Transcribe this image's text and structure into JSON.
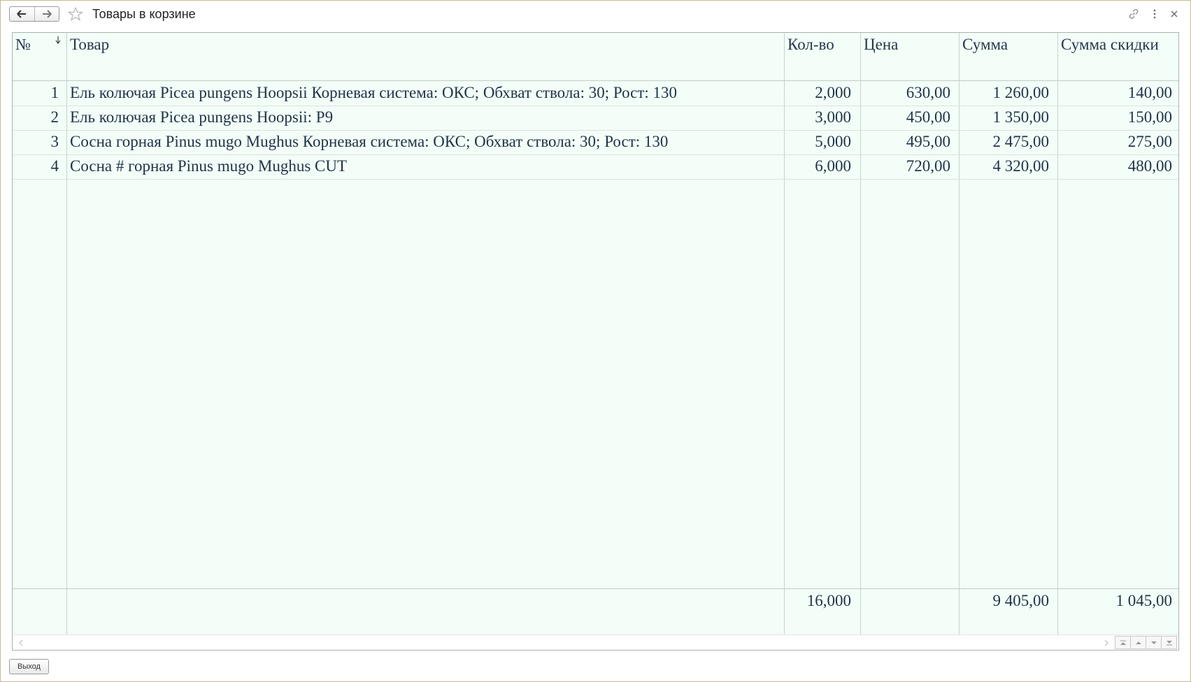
{
  "window": {
    "title": "Товары в корзине"
  },
  "table": {
    "columns": {
      "num": "№",
      "product": "Товар",
      "qty": "Кол-во",
      "price": "Цена",
      "sum": "Сумма",
      "discount": "Сумма скидки"
    },
    "rows": [
      {
        "num": "1",
        "product": "Ель колючая Picea pungens Hoopsii Корневая система: ОКС; Обхват ствола: 30; Рост: 130",
        "qty": "2,000",
        "price": "630,00",
        "sum": "1 260,00",
        "discount": "140,00"
      },
      {
        "num": "2",
        "product": "Ель колючая Picea pungens Hoopsii: Р9",
        "qty": "3,000",
        "price": "450,00",
        "sum": "1 350,00",
        "discount": "150,00"
      },
      {
        "num": "3",
        "product": "Сосна горная Pinus mugo Mughus  Корневая система: ОКС; Обхват ствола: 30; Рост: 130",
        "qty": "5,000",
        "price": "495,00",
        "sum": "2 475,00",
        "discount": "275,00"
      },
      {
        "num": "4",
        "product": "Сосна # горная Pinus mugo Mughus CUT",
        "qty": "6,000",
        "price": "720,00",
        "sum": "4 320,00",
        "discount": "480,00"
      }
    ],
    "totals": {
      "qty": "16,000",
      "sum": "9 405,00",
      "discount": "1 045,00"
    }
  },
  "buttons": {
    "exit": "Выход"
  },
  "icons": {
    "back": "arrow-left-icon",
    "forward": "arrow-right-icon",
    "favorite": "star-icon",
    "link": "link-icon",
    "more": "more-vertical-icon",
    "close": "close-icon",
    "sort": "sort-down-icon"
  }
}
